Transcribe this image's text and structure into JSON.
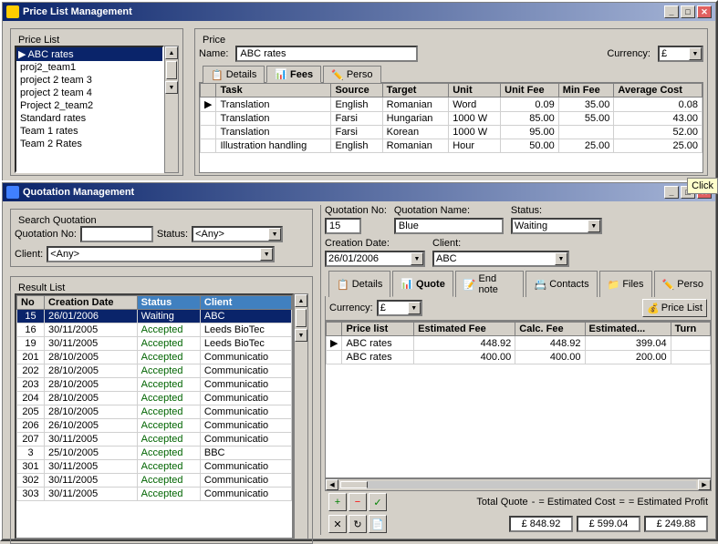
{
  "priceWindow": {
    "title": "Price List Management",
    "priceListGroup": "Price List",
    "priceGroup": "Price",
    "nameLabel": "Name:",
    "currencyLabel": "Currency:",
    "nameValue": "ABC rates",
    "currencyValue": "£",
    "priceListItems": [
      {
        "label": "ABC rates",
        "selected": true
      },
      {
        "label": "proj2_team1"
      },
      {
        "label": "project 2 team 3"
      },
      {
        "label": "project 2 team 4"
      },
      {
        "label": "Project 2_team2"
      },
      {
        "label": "Standard rates"
      },
      {
        "label": "Team 1 rates"
      },
      {
        "label": "Team 2 Rates"
      }
    ],
    "tabs": [
      {
        "label": "Details",
        "icon": "📋"
      },
      {
        "label": "Fees",
        "icon": "📊"
      },
      {
        "label": "Perso",
        "icon": "✏️"
      }
    ],
    "tableHeaders": [
      "Task",
      "Source",
      "Target",
      "Unit",
      "Unit Fee",
      "Min Fee",
      "Average Cost"
    ],
    "tableRows": [
      {
        "task": "Translation",
        "source": "English",
        "target": "Romanian",
        "unit": "Word",
        "unitFee": "0.09",
        "minFee": "35.00",
        "avgCost": "0.08"
      },
      {
        "task": "Translation",
        "source": "Farsi",
        "target": "Hungarian",
        "unit": "1000 W",
        "unitFee": "85.00",
        "minFee": "55.00",
        "avgCost": "43.00"
      },
      {
        "task": "Translation",
        "source": "Farsi",
        "target": "Korean",
        "unit": "1000 W",
        "unitFee": "95.00",
        "minFee": "",
        "avgCost": "52.00"
      },
      {
        "task": "Illustration handling",
        "source": "English",
        "target": "Romanian",
        "unit": "Hour",
        "unitFee": "50.00",
        "minFee": "25.00",
        "avgCost": "25.00"
      }
    ],
    "titleBtns": [
      "_",
      "□",
      "✕"
    ]
  },
  "quotWindow": {
    "title": "Quotation Management",
    "titleBtns": [
      "_",
      "□",
      "✕"
    ],
    "searchGroup": "Search Quotation",
    "resultGroup": "Result List",
    "quotNoLabel": "Quotation No:",
    "statusLabel": "Status:",
    "clientLabel": "Client:",
    "statusOptions": [
      "<Any>"
    ],
    "clientOptions": [
      "<Any>"
    ],
    "quotNoValue": "",
    "statusValue": "<Any>",
    "clientValue": "<Any>",
    "resultHeaders": [
      "No",
      "Creation Date",
      "Status",
      "Client"
    ],
    "resultRows": [
      {
        "no": "15",
        "date": "26/01/2006",
        "status": "Waiting",
        "client": "ABC",
        "selected": true
      },
      {
        "no": "16",
        "date": "30/11/2005",
        "status": "Accepted",
        "client": "Leeds BioTec"
      },
      {
        "no": "19",
        "date": "30/11/2005",
        "status": "Accepted",
        "client": "Leeds BioTec"
      },
      {
        "no": "201",
        "date": "28/10/2005",
        "status": "Accepted",
        "client": "Communication"
      },
      {
        "no": "202",
        "date": "28/10/2005",
        "status": "Accepted",
        "client": "Communication"
      },
      {
        "no": "203",
        "date": "28/10/2005",
        "status": "Accepted",
        "client": "Communication"
      },
      {
        "no": "204",
        "date": "28/10/2005",
        "status": "Accepted",
        "client": "Communication"
      },
      {
        "no": "205",
        "date": "28/10/2005",
        "status": "Accepted",
        "client": "Communication"
      },
      {
        "no": "206",
        "date": "26/10/2005",
        "status": "Accepted",
        "client": "Communication"
      },
      {
        "no": "207",
        "date": "30/11/2005",
        "status": "Accepted",
        "client": "Communication"
      },
      {
        "no": "3",
        "date": "25/10/2005",
        "status": "Accepted",
        "client": "BBC"
      },
      {
        "no": "301",
        "date": "30/11/2005",
        "status": "Accepted",
        "client": "Communication"
      },
      {
        "no": "302",
        "date": "30/11/2005",
        "status": "Accepted",
        "client": "Communication"
      },
      {
        "no": "303",
        "date": "30/11/2005",
        "status": "Accepted",
        "client": "Communication"
      }
    ],
    "detailQuotNo": "Quotation No:",
    "detailQuotNoVal": "15",
    "detailQuotName": "Quotation Name:",
    "detailQuotNameVal": "Blue",
    "detailStatus": "Status:",
    "detailStatusVal": "Waiting",
    "detailCreationDate": "Creation Date:",
    "detailCreationDateVal": "26/01/2006",
    "detailClient": "Client:",
    "detailClientVal": "ABC",
    "detailTabs": [
      {
        "label": "Details",
        "icon": "📋"
      },
      {
        "label": "Quote",
        "icon": "📊"
      },
      {
        "label": "End note",
        "icon": "📝"
      },
      {
        "label": "Contacts",
        "icon": "📇"
      },
      {
        "label": "Files",
        "icon": "📁"
      },
      {
        "label": "Perso",
        "icon": "✏️"
      }
    ],
    "currencyLabel": "Currency:",
    "currencyValue": "£",
    "priceListBtn": "Price List",
    "priceListHeaders": [
      "Price list",
      "Estimated Fee",
      "Calc. Fee",
      "Estimated...",
      "Turn"
    ],
    "priceListRows": [
      {
        "pricelist": "ABC rates",
        "estFee": "448.92",
        "calcFee": "448.92",
        "estimated": "399.04"
      },
      {
        "pricelist": "ABC rates",
        "estFee": "400.00",
        "calcFee": "400.00",
        "estimated": "200.00"
      }
    ],
    "totalQuoteLabel": "Total Quote",
    "estCostLabel": "= Estimated Cost",
    "estProfitLabel": "= Estimated Profit",
    "totalQuoteVal": "£ 848.92",
    "estCostVal": "£ 599.04",
    "estProfitVal": "£ 249.88",
    "clickLabel": "Click"
  }
}
